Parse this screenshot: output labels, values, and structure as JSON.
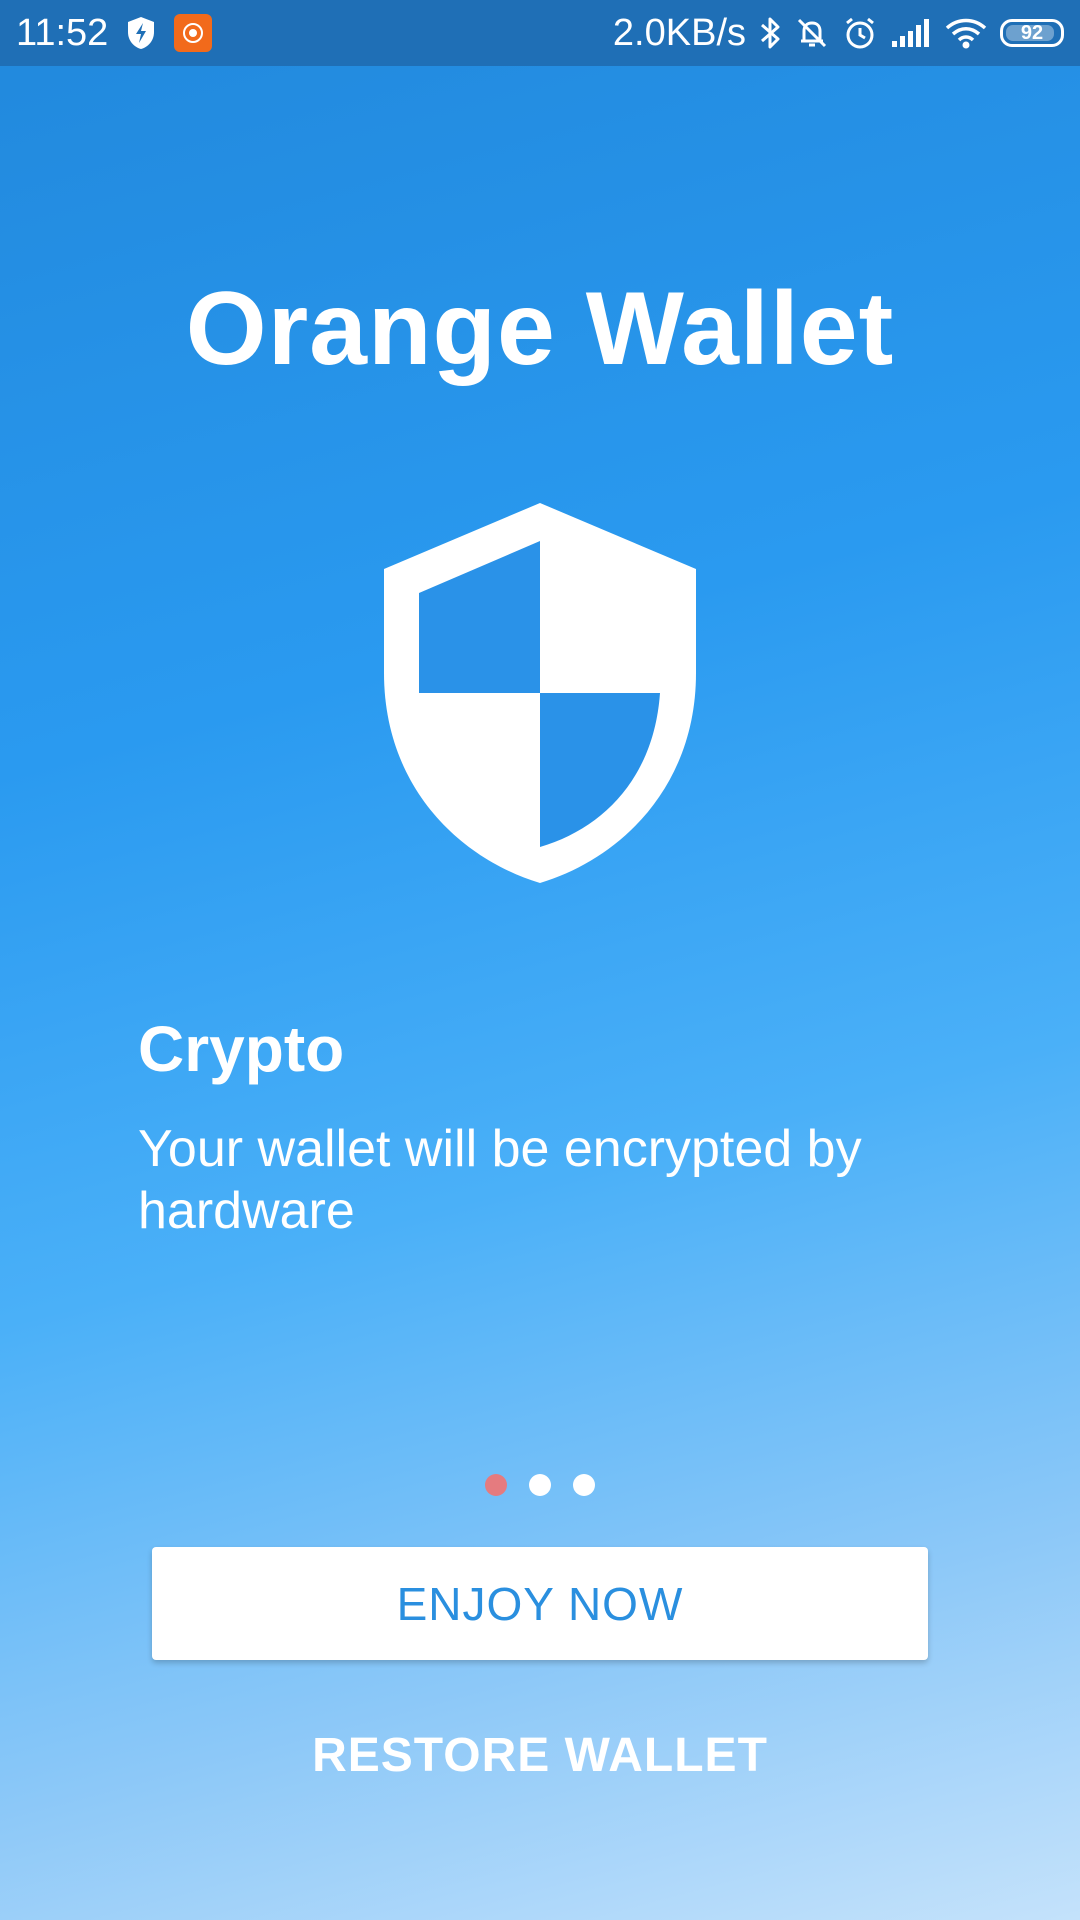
{
  "status_bar": {
    "time": "11:52",
    "network_speed": "2.0KB/s",
    "battery_level": "92",
    "battery_fraction": 0.92,
    "icons": [
      "shield-bolt-icon",
      "mi-app-icon",
      "bluetooth-icon",
      "notifications-muted-icon",
      "alarm-icon",
      "signal-icon",
      "wifi-icon",
      "battery-icon"
    ]
  },
  "header": {
    "app_title": "Orange Wallet"
  },
  "slide": {
    "icon": "shield-icon",
    "title": "Crypto",
    "description": "Your wallet will be encrypted by hardware"
  },
  "pager": {
    "count": 3,
    "active_index": 0
  },
  "actions": {
    "primary_label": "ENJOY NOW",
    "secondary_label": "RESTORE WALLET"
  },
  "colors": {
    "status_bar": "#1f6fb6",
    "accent": "#2a8fdf",
    "active_dot": "#e57b7f"
  }
}
